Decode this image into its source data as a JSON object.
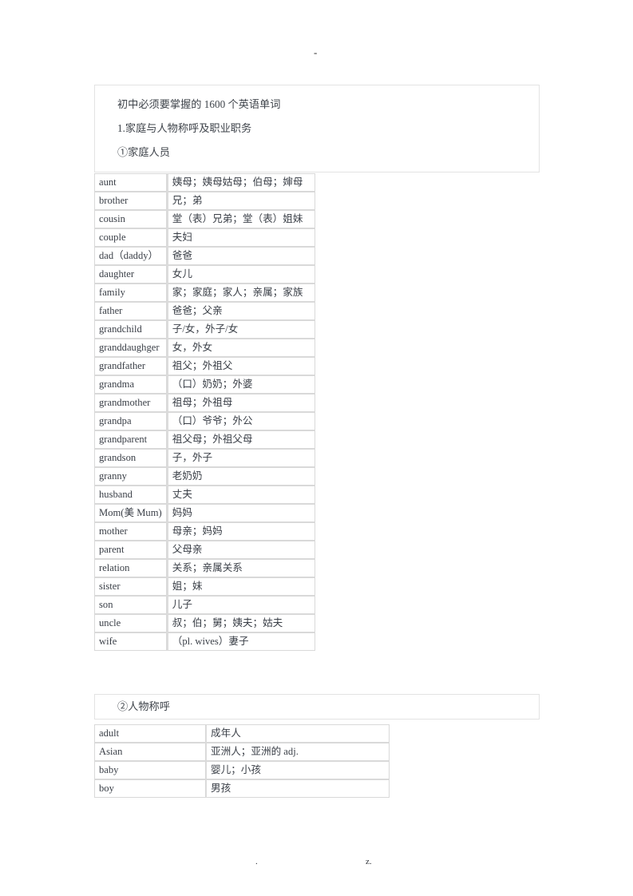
{
  "page": {
    "top_mark": "-",
    "footer_left": ".",
    "footer_right": "z."
  },
  "header": {
    "title": "初中必须要掌握的 1600 个英语单词",
    "section": "1.家庭与人物称呼及职业职务",
    "subsection": "①家庭人员"
  },
  "section2": {
    "subsection": "②人物称呼"
  },
  "tables": {
    "family": {
      "rows": [
        {
          "term": "aunt",
          "meaning": "姨母；姨母姑母；伯母；婶母"
        },
        {
          "term": "brother",
          "meaning": "兄；弟"
        },
        {
          "term": "cousin",
          "meaning": "堂（表）兄弟；堂（表）姐妹"
        },
        {
          "term": "couple",
          "meaning": "夫妇"
        },
        {
          "term": "dad（daddy）",
          "meaning": "爸爸"
        },
        {
          "term": "daughter",
          "meaning": "女儿"
        },
        {
          "term": "family",
          "meaning": "家；家庭；家人；亲属；家族"
        },
        {
          "term": "father",
          "meaning": "爸爸；父亲"
        },
        {
          "term": "grandchild",
          "meaning": "子/女，外子/女"
        },
        {
          "term": "granddaughger",
          "meaning": "女，外女"
        },
        {
          "term": "grandfather",
          "meaning": "祖父；外祖父"
        },
        {
          "term": "grandma",
          "meaning": "（口）奶奶；外婆"
        },
        {
          "term": "grandmother",
          "meaning": "祖母；外祖母"
        },
        {
          "term": "grandpa",
          "meaning": "（口）爷爷；外公"
        },
        {
          "term": "grandparent",
          "meaning": "祖父母；外祖父母"
        },
        {
          "term": "grandson",
          "meaning": "子，外子"
        },
        {
          "term": "granny",
          "meaning": "老奶奶"
        },
        {
          "term": "husband",
          "meaning": "丈夫"
        },
        {
          "term": "Mom(美 Mum)",
          "meaning": "妈妈"
        },
        {
          "term": "mother",
          "meaning": "母亲；妈妈"
        },
        {
          "term": "parent",
          "meaning": "父母亲"
        },
        {
          "term": "relation",
          "meaning": "关系；亲属关系"
        },
        {
          "term": "sister",
          "meaning": "姐；妹"
        },
        {
          "term": "son",
          "meaning": "儿子"
        },
        {
          "term": "uncle",
          "meaning": "叔；伯；舅；姨夫；姑夫"
        },
        {
          "term": "wife",
          "meaning": "（pl. wives）妻子"
        }
      ]
    },
    "person": {
      "rows": [
        {
          "term": "adult",
          "meaning": "成年人"
        },
        {
          "term": "Asian",
          "meaning": "亚洲人；亚洲的 adj."
        },
        {
          "term": "baby",
          "meaning": "婴儿；小孩"
        },
        {
          "term": "boy",
          "meaning": "男孩"
        }
      ]
    }
  }
}
